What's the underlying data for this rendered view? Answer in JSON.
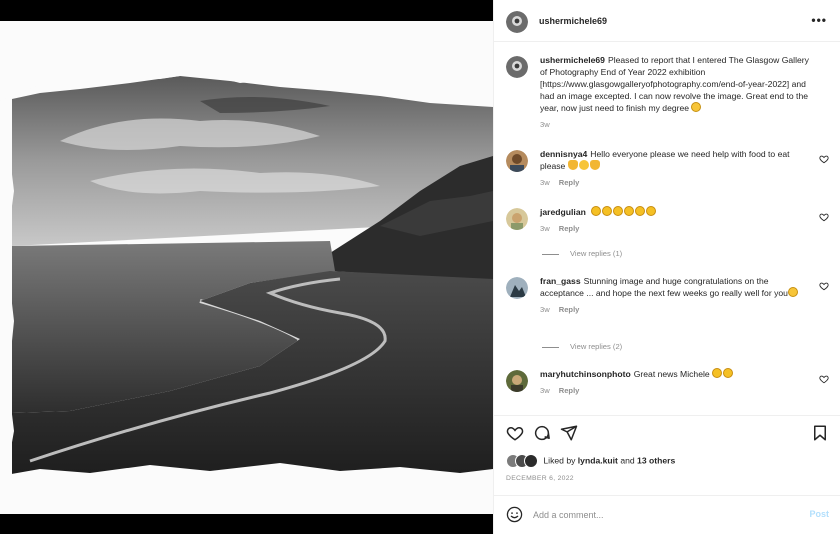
{
  "post": {
    "author": "ushermichele69",
    "more_icon": "more-horizontal-icon",
    "caption": {
      "username": "ushermichele69",
      "text": "Pleased to report that I entered The Glasgow Gallery of Photography End of Year 2022 exhibition [https://www.glasgowgalleryofphotography.com/end-of-year-2022] and had an image excepted. I can now revolve the image. Great end to the year, now just need to finish my degree",
      "time": "3w"
    },
    "comments": [
      {
        "username": "dennisnya4",
        "text": "Hello everyone please we need help with food to eat please",
        "time": "3w",
        "reply": "Reply"
      },
      {
        "username": "jaredgulian",
        "text": "",
        "time": "3w",
        "reply": "Reply",
        "view_replies": "View replies (1)"
      },
      {
        "username": "fran_gass",
        "text": "Stunning image and huge congratulations on the acceptance ... and hope the next few weeks go really well for you",
        "time": "3w",
        "reply": "Reply",
        "view_replies": "View replies (2)"
      },
      {
        "username": "maryhutchinsonphoto",
        "text": "Great news Michele",
        "time": "3w",
        "reply": "Reply"
      }
    ],
    "likes": {
      "prefix": "Liked by",
      "user": "lynda.kuit",
      "middle": "and",
      "others": "13 others"
    },
    "date": "DECEMBER 6, 2022",
    "add_comment": {
      "placeholder": "Add a comment...",
      "post_label": "Post"
    }
  },
  "icons": [
    "heart-icon",
    "comment-icon",
    "share-icon",
    "bookmark-icon",
    "emoji-smile-icon"
  ],
  "colors": {
    "link_disabled": "#b2dffc",
    "muted": "#8e8e8e",
    "text": "#262626"
  }
}
